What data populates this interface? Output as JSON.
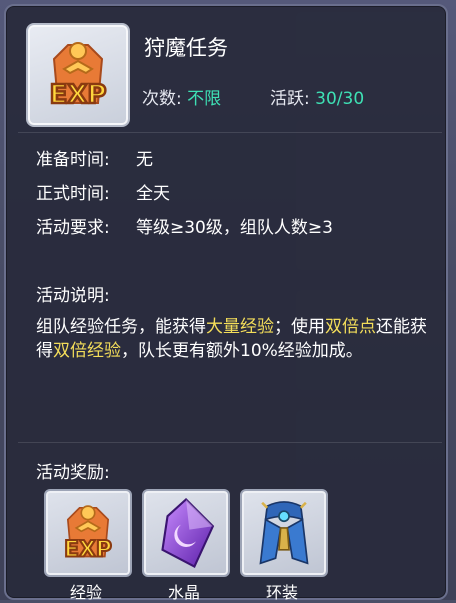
{
  "activity": {
    "title": "狩魔任务",
    "count_label": "次数:",
    "count_value": "不限",
    "active_label": "活跃:",
    "active_value": "30/30"
  },
  "info": [
    {
      "key": "准备时间:",
      "value": "无"
    },
    {
      "key": "正式时间:",
      "value": "全天"
    },
    {
      "key": "活动要求:",
      "value": "等级≥30级，组队人数≥3"
    }
  ],
  "description": {
    "label": "活动说明:",
    "segments": [
      {
        "text": "组队经验任务，能获得",
        "highlight": false
      },
      {
        "text": "大量经验",
        "highlight": true
      },
      {
        "text": "；使用",
        "highlight": false
      },
      {
        "text": "双倍点",
        "highlight": true
      },
      {
        "text": "还能获得",
        "highlight": false
      },
      {
        "text": "双倍经验",
        "highlight": true
      },
      {
        "text": "，队长更有额外10%经验加成。",
        "highlight": false
      }
    ]
  },
  "rewards": {
    "label": "活动奖励:",
    "items": [
      {
        "name": "经验",
        "icon": "exp-icon"
      },
      {
        "name": "水晶",
        "icon": "crystal-icon"
      },
      {
        "name": "环装",
        "icon": "ring-equipment-icon"
      }
    ]
  },
  "icon_text": "EXP",
  "colors": {
    "highlight": "#f4de5a",
    "value_green": "#3ee0b4"
  }
}
